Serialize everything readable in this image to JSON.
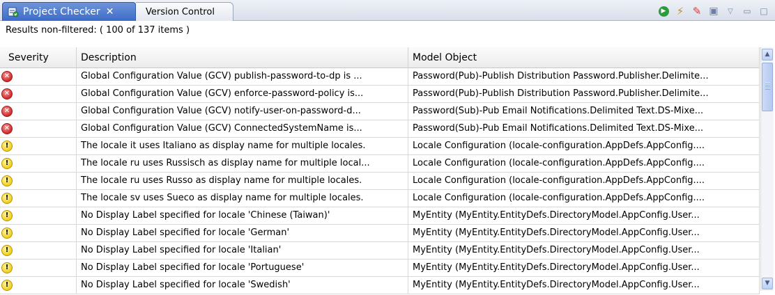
{
  "tabs": {
    "active": {
      "label": "Project Checker",
      "icon": "project-checker-icon",
      "close": "✕"
    },
    "inactive": {
      "label": "Version Control"
    }
  },
  "toolbar": {
    "icons": [
      "run-icon",
      "filter-icon",
      "clear-icon",
      "save-icon",
      "view-menu-icon",
      "minimize-icon",
      "maximize-icon"
    ]
  },
  "status": {
    "text": "Results non-filtered: ( 100 of 137 items )"
  },
  "table": {
    "columns": [
      "Severity",
      "Description",
      "Model Object"
    ],
    "rows": [
      {
        "severity": "error",
        "description": "Global Configuration Value (GCV) publish-password-to-dp is ...",
        "model_object": "Password(Pub)-Publish Distribution Password.Publisher.Delimite..."
      },
      {
        "severity": "error",
        "description": "Global Configuration Value (GCV) enforce-password-policy is...",
        "model_object": "Password(Pub)-Publish Distribution Password.Publisher.Delimite..."
      },
      {
        "severity": "error",
        "description": "Global Configuration Value (GCV) notify-user-on-password-d...",
        "model_object": "Password(Sub)-Pub Email Notifications.Delimited Text.DS-Mixe..."
      },
      {
        "severity": "error",
        "description": "Global Configuration Value (GCV) ConnectedSystemName is...",
        "model_object": "Password(Sub)-Pub Email Notifications.Delimited Text.DS-Mixe..."
      },
      {
        "severity": "warning",
        "description": "The locale it uses Italiano as display name for multiple locales.",
        "model_object": "Locale Configuration (locale-configuration.AppDefs.AppConfig...."
      },
      {
        "severity": "warning",
        "description": "The locale ru uses Russisch as display name for multiple local...",
        "model_object": "Locale Configuration (locale-configuration.AppDefs.AppConfig...."
      },
      {
        "severity": "warning",
        "description": "The locale ru uses Russo as display name for multiple locales.",
        "model_object": "Locale Configuration (locale-configuration.AppDefs.AppConfig...."
      },
      {
        "severity": "warning",
        "description": "The locale sv uses Sueco as display name for multiple locales.",
        "model_object": "Locale Configuration (locale-configuration.AppDefs.AppConfig...."
      },
      {
        "severity": "warning",
        "description": "No Display Label specified for locale 'Chinese (Taiwan)'",
        "model_object": "MyEntity (MyEntity.EntityDefs.DirectoryModel.AppConfig.User..."
      },
      {
        "severity": "warning",
        "description": "No Display Label specified for locale 'German'",
        "model_object": "MyEntity (MyEntity.EntityDefs.DirectoryModel.AppConfig.User..."
      },
      {
        "severity": "warning",
        "description": "No Display Label specified for locale 'Italian'",
        "model_object": "MyEntity (MyEntity.EntityDefs.DirectoryModel.AppConfig.User..."
      },
      {
        "severity": "warning",
        "description": "No Display Label specified for locale 'Portuguese'",
        "model_object": "MyEntity (MyEntity.EntityDefs.DirectoryModel.AppConfig.User..."
      },
      {
        "severity": "warning",
        "description": "No Display Label specified for locale 'Swedish'",
        "model_object": "MyEntity (MyEntity.EntityDefs.DirectoryModel.AppConfig.User..."
      }
    ]
  },
  "scrollbar": {
    "up_icon": "scroll-up-icon",
    "down_icon": "scroll-down-icon"
  },
  "colors": {
    "active_tab": "#3c6bc9",
    "error": "#d12a2a",
    "warning": "#f1cf1e"
  }
}
